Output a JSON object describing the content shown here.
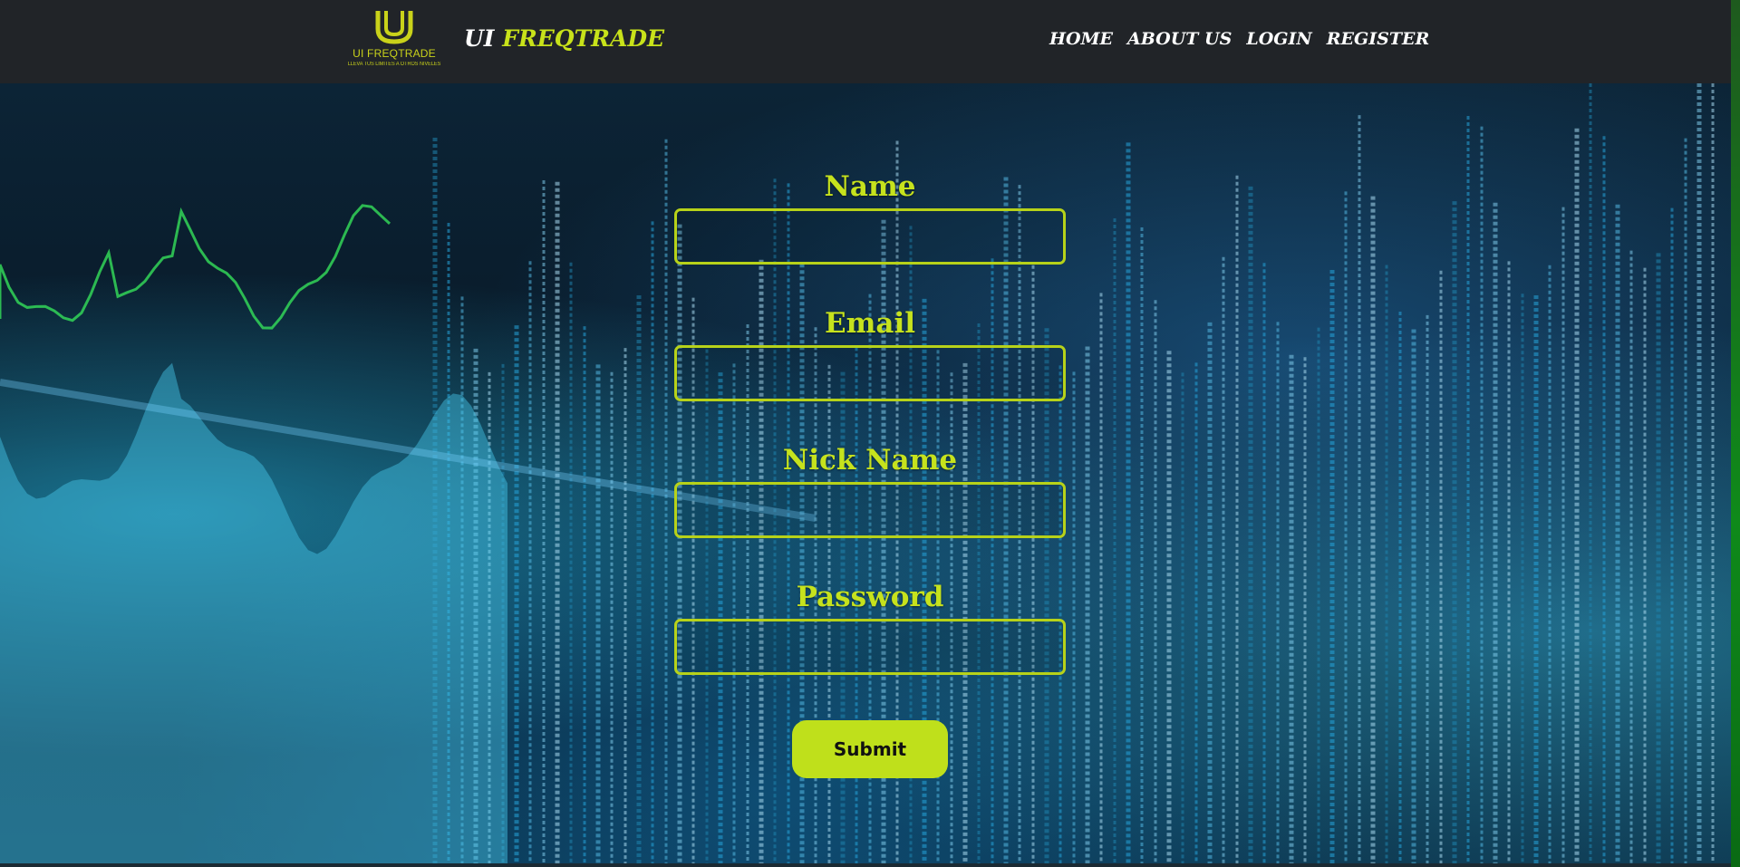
{
  "header": {
    "logo": {
      "name": "UI FREQTRADE",
      "tagline": "LLEVA TUS LIMITES A OTROS NIVELES"
    },
    "brand": {
      "prefix": "UI",
      "main": "FREQTRADE"
    },
    "nav": [
      {
        "label": "HOME"
      },
      {
        "label": "ABOUT US"
      },
      {
        "label": "LOGIN"
      },
      {
        "label": "REGISTER"
      }
    ]
  },
  "form": {
    "fields": [
      {
        "label": "Name",
        "value": "",
        "type": "text"
      },
      {
        "label": "Email",
        "value": "",
        "type": "email"
      },
      {
        "label": "Nick Name",
        "value": "",
        "type": "text"
      },
      {
        "label": "Password",
        "value": "",
        "type": "password"
      }
    ],
    "submit_label": "Submit"
  },
  "colors": {
    "accent": "#c6e21d",
    "header_bg": "#212428",
    "input_border": "#b7d219",
    "button_bg": "#bfe01b"
  },
  "icons": {
    "logo": "u-logo-icon"
  }
}
